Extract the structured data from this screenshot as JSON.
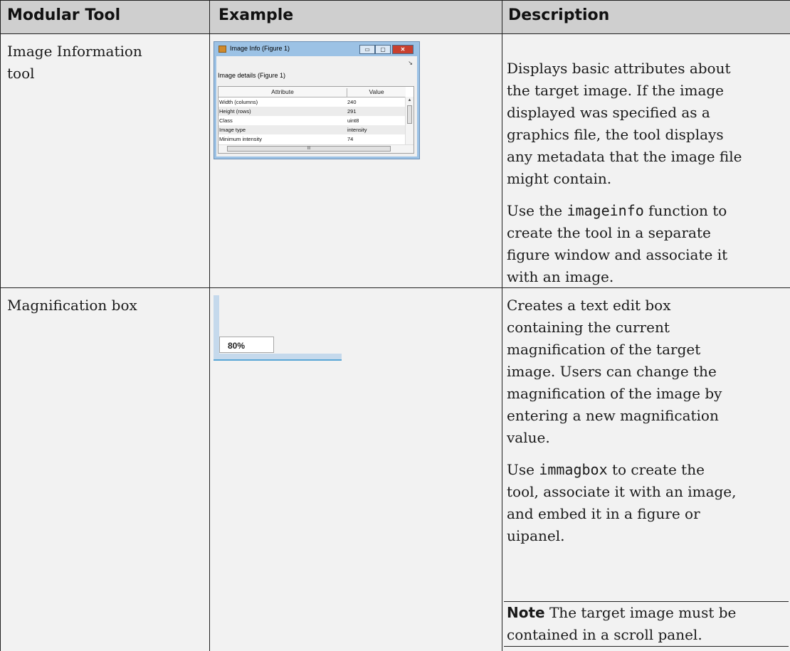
{
  "headers": [
    "Modular Tool",
    "Example",
    "Description"
  ],
  "rows": [
    {
      "tool": [
        "Image Information",
        "tool"
      ],
      "description_paragraphs": [
        [
          "Displays basic attributes about",
          "the target image. If the image",
          "displayed was specified as a",
          "graphics file, the tool displays",
          "any metadata that the image file",
          "might contain."
        ]
      ],
      "usage": {
        "prefix": "Use the ",
        "code": "imageinfo",
        "suffix": " function to",
        "lines": [
          "create the tool in a separate",
          "figure window and associate it",
          "with an image."
        ]
      }
    },
    {
      "tool": [
        "Magnification box"
      ],
      "description_paragraphs": [
        [
          "Creates a text edit box",
          "containing the current",
          "magnification of the target",
          "image. Users can change the",
          "magnification of the image by",
          "entering a new magnification",
          "value."
        ]
      ],
      "usage": {
        "prefix": "Use ",
        "code": "immagbox",
        "suffix": " to create the",
        "lines": [
          "tool, associate it with an image,",
          "and embed it in a figure or",
          "uipanel."
        ]
      },
      "note": {
        "label": "Note",
        "lines": [
          "  The target image must be",
          "contained in a scroll panel."
        ]
      }
    }
  ],
  "image_info_window": {
    "title": "Image Info (Figure 1)",
    "details_label": "Image details  (Figure 1)",
    "columns": [
      "Attribute",
      "Value"
    ],
    "rows": [
      {
        "attr": "Width (columns)",
        "value": "240"
      },
      {
        "attr": "Height (rows)",
        "value": "291"
      },
      {
        "attr": "Class",
        "value": "uint8"
      },
      {
        "attr": "Image type",
        "value": "intensity"
      },
      {
        "attr": "Minimum intensity",
        "value": "74"
      }
    ],
    "hscroll_grip": "III"
  },
  "magnification_box": {
    "value": "80%"
  }
}
